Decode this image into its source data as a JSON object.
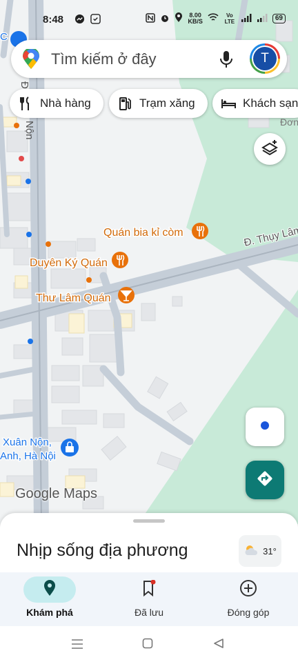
{
  "status": {
    "time": "8:48",
    "speed_top": "8.00",
    "speed_bottom": "KB/S",
    "volte": "Vo LTE",
    "battery": "69"
  },
  "search": {
    "placeholder": "Tìm kiếm ở đây",
    "avatar_letter": "T"
  },
  "chips": [
    {
      "label": "Nhà hàng",
      "icon": "fork-knife-icon"
    },
    {
      "label": "Trạm xăng",
      "icon": "gas-pump-icon"
    },
    {
      "label": "Khách sạn",
      "icon": "bed-icon"
    }
  ],
  "map": {
    "places": [
      {
        "name": "Quán bia kỉ còm",
        "icon": "restaurant-icon"
      },
      {
        "name": "Duyên Ký Quán",
        "icon": "restaurant-icon"
      },
      {
        "name": "Thư Lâm Quán",
        "icon": "bar-icon"
      }
    ],
    "street_1": "Đ. Thụy Lâm",
    "street_2": "Nộn",
    "street_3": "Đ",
    "area_label_1": "Xuân Nộn,",
    "area_label_2": "Anh, Hà Nội",
    "corner_label": "Đơn",
    "corner_left": "C",
    "colors": {
      "accent": "#e8710a",
      "road": "#c5ced8",
      "park": "#c8ead8",
      "teal": "#0d7a74"
    }
  },
  "logo": {
    "google": "Google",
    "maps": "Maps"
  },
  "sheet": {
    "title": "Nhịp sống địa phương",
    "temperature": "31°"
  },
  "nav": [
    {
      "label": "Khám phá",
      "icon": "explore-pin-icon",
      "active": true
    },
    {
      "label": "Đã lưu",
      "icon": "bookmark-icon",
      "active": false
    },
    {
      "label": "Đóng góp",
      "icon": "add-circle-icon",
      "active": false
    }
  ]
}
